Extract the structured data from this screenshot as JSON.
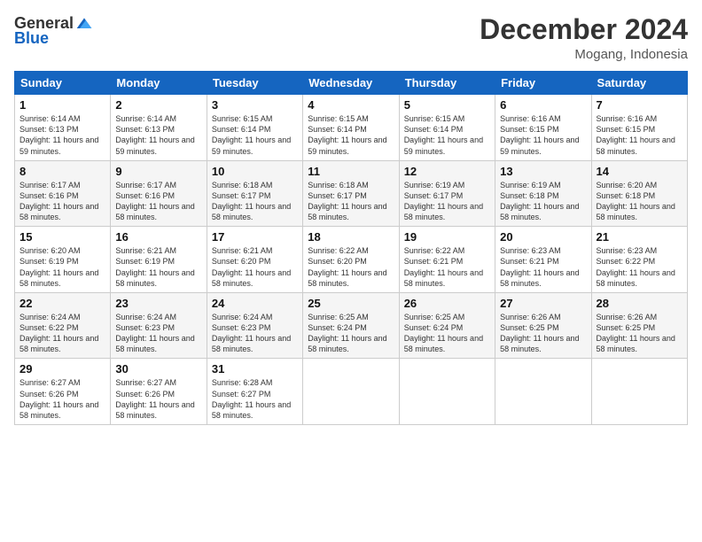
{
  "logo": {
    "general": "General",
    "blue": "Blue"
  },
  "header": {
    "month": "December 2024",
    "location": "Mogang, Indonesia"
  },
  "weekdays": [
    "Sunday",
    "Monday",
    "Tuesday",
    "Wednesday",
    "Thursday",
    "Friday",
    "Saturday"
  ],
  "weeks": [
    [
      {
        "day": "1",
        "sunrise": "6:14 AM",
        "sunset": "6:13 PM",
        "daylight": "11 hours and 59 minutes."
      },
      {
        "day": "2",
        "sunrise": "6:14 AM",
        "sunset": "6:13 PM",
        "daylight": "11 hours and 59 minutes."
      },
      {
        "day": "3",
        "sunrise": "6:15 AM",
        "sunset": "6:14 PM",
        "daylight": "11 hours and 59 minutes."
      },
      {
        "day": "4",
        "sunrise": "6:15 AM",
        "sunset": "6:14 PM",
        "daylight": "11 hours and 59 minutes."
      },
      {
        "day": "5",
        "sunrise": "6:15 AM",
        "sunset": "6:14 PM",
        "daylight": "11 hours and 59 minutes."
      },
      {
        "day": "6",
        "sunrise": "6:16 AM",
        "sunset": "6:15 PM",
        "daylight": "11 hours and 59 minutes."
      },
      {
        "day": "7",
        "sunrise": "6:16 AM",
        "sunset": "6:15 PM",
        "daylight": "11 hours and 58 minutes."
      }
    ],
    [
      {
        "day": "8",
        "sunrise": "6:17 AM",
        "sunset": "6:16 PM",
        "daylight": "11 hours and 58 minutes."
      },
      {
        "day": "9",
        "sunrise": "6:17 AM",
        "sunset": "6:16 PM",
        "daylight": "11 hours and 58 minutes."
      },
      {
        "day": "10",
        "sunrise": "6:18 AM",
        "sunset": "6:17 PM",
        "daylight": "11 hours and 58 minutes."
      },
      {
        "day": "11",
        "sunrise": "6:18 AM",
        "sunset": "6:17 PM",
        "daylight": "11 hours and 58 minutes."
      },
      {
        "day": "12",
        "sunrise": "6:19 AM",
        "sunset": "6:17 PM",
        "daylight": "11 hours and 58 minutes."
      },
      {
        "day": "13",
        "sunrise": "6:19 AM",
        "sunset": "6:18 PM",
        "daylight": "11 hours and 58 minutes."
      },
      {
        "day": "14",
        "sunrise": "6:20 AM",
        "sunset": "6:18 PM",
        "daylight": "11 hours and 58 minutes."
      }
    ],
    [
      {
        "day": "15",
        "sunrise": "6:20 AM",
        "sunset": "6:19 PM",
        "daylight": "11 hours and 58 minutes."
      },
      {
        "day": "16",
        "sunrise": "6:21 AM",
        "sunset": "6:19 PM",
        "daylight": "11 hours and 58 minutes."
      },
      {
        "day": "17",
        "sunrise": "6:21 AM",
        "sunset": "6:20 PM",
        "daylight": "11 hours and 58 minutes."
      },
      {
        "day": "18",
        "sunrise": "6:22 AM",
        "sunset": "6:20 PM",
        "daylight": "11 hours and 58 minutes."
      },
      {
        "day": "19",
        "sunrise": "6:22 AM",
        "sunset": "6:21 PM",
        "daylight": "11 hours and 58 minutes."
      },
      {
        "day": "20",
        "sunrise": "6:23 AM",
        "sunset": "6:21 PM",
        "daylight": "11 hours and 58 minutes."
      },
      {
        "day": "21",
        "sunrise": "6:23 AM",
        "sunset": "6:22 PM",
        "daylight": "11 hours and 58 minutes."
      }
    ],
    [
      {
        "day": "22",
        "sunrise": "6:24 AM",
        "sunset": "6:22 PM",
        "daylight": "11 hours and 58 minutes."
      },
      {
        "day": "23",
        "sunrise": "6:24 AM",
        "sunset": "6:23 PM",
        "daylight": "11 hours and 58 minutes."
      },
      {
        "day": "24",
        "sunrise": "6:24 AM",
        "sunset": "6:23 PM",
        "daylight": "11 hours and 58 minutes."
      },
      {
        "day": "25",
        "sunrise": "6:25 AM",
        "sunset": "6:24 PM",
        "daylight": "11 hours and 58 minutes."
      },
      {
        "day": "26",
        "sunrise": "6:25 AM",
        "sunset": "6:24 PM",
        "daylight": "11 hours and 58 minutes."
      },
      {
        "day": "27",
        "sunrise": "6:26 AM",
        "sunset": "6:25 PM",
        "daylight": "11 hours and 58 minutes."
      },
      {
        "day": "28",
        "sunrise": "6:26 AM",
        "sunset": "6:25 PM",
        "daylight": "11 hours and 58 minutes."
      }
    ],
    [
      {
        "day": "29",
        "sunrise": "6:27 AM",
        "sunset": "6:26 PM",
        "daylight": "11 hours and 58 minutes."
      },
      {
        "day": "30",
        "sunrise": "6:27 AM",
        "sunset": "6:26 PM",
        "daylight": "11 hours and 58 minutes."
      },
      {
        "day": "31",
        "sunrise": "6:28 AM",
        "sunset": "6:27 PM",
        "daylight": "11 hours and 58 minutes."
      },
      null,
      null,
      null,
      null
    ]
  ],
  "labels": {
    "sunrise": "Sunrise:",
    "sunset": "Sunset:",
    "daylight": "Daylight:"
  }
}
